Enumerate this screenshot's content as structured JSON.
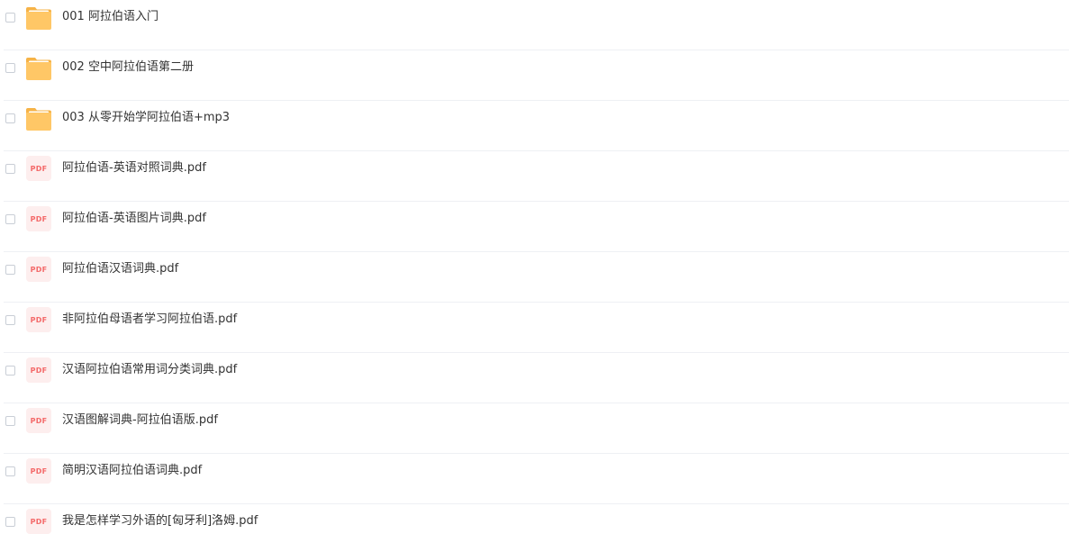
{
  "files": [
    {
      "type": "folder",
      "icon": "folder-icon",
      "name": "001 阿拉伯语入门"
    },
    {
      "type": "folder",
      "icon": "folder-icon",
      "name": "002 空中阿拉伯语第二册"
    },
    {
      "type": "folder",
      "icon": "folder-icon",
      "name": "003 从零开始学阿拉伯语+mp3"
    },
    {
      "type": "pdf",
      "icon": "pdf-icon",
      "badge": "PDF",
      "name": "阿拉伯语-英语对照词典.pdf"
    },
    {
      "type": "pdf",
      "icon": "pdf-icon",
      "badge": "PDF",
      "name": "阿拉伯语-英语图片词典.pdf"
    },
    {
      "type": "pdf",
      "icon": "pdf-icon",
      "badge": "PDF",
      "name": "阿拉伯语汉语词典.pdf"
    },
    {
      "type": "pdf",
      "icon": "pdf-icon",
      "badge": "PDF",
      "name": "非阿拉伯母语者学习阿拉伯语.pdf"
    },
    {
      "type": "pdf",
      "icon": "pdf-icon",
      "badge": "PDF",
      "name": "汉语阿拉伯语常用词分类词典.pdf"
    },
    {
      "type": "pdf",
      "icon": "pdf-icon",
      "badge": "PDF",
      "name": "汉语图解词典-阿拉伯语版.pdf"
    },
    {
      "type": "pdf",
      "icon": "pdf-icon",
      "badge": "PDF",
      "name": "简明汉语阿拉伯语词典.pdf"
    },
    {
      "type": "pdf",
      "icon": "pdf-icon",
      "badge": "PDF",
      "name": "我是怎样学习外语的[匈牙利]洛姆.pdf"
    }
  ],
  "colors": {
    "folder_body": "#ffc766",
    "folder_tab": "#f6b347",
    "folder_paper": "#ffffff",
    "pdf_background": "#fdeeee",
    "pdf_text": "#f46a6a",
    "divider": "#eef0f4",
    "text": "#333333"
  }
}
